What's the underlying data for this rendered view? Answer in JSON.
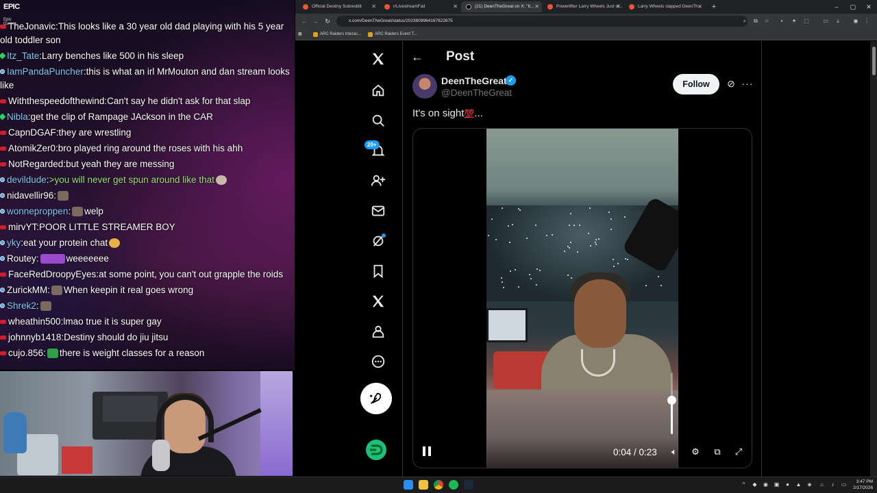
{
  "stream": {
    "logo_text": "EPIC",
    "logo_sub": "Epic Games",
    "chat": [
      {
        "badge": "red",
        "user": "TheJonavic",
        "text": "This looks like a 30 year old dad playing with his 5 year old toddler son",
        "user_color": "white"
      },
      {
        "badge": "green",
        "user": "Itz_Tate",
        "text": "Larry benches like 500 in his sleep",
        "user_color": "lblue"
      },
      {
        "badge": "blue",
        "user": "IamPandaPuncher",
        "text": "this is what an irl MrMouton and dan stream looks like",
        "user_color": "lblue"
      },
      {
        "badge": "red",
        "user": "Withthespeedofthewind",
        "text": "Can't say he didn't ask for that slap",
        "user_color": "white"
      },
      {
        "badge": "green",
        "user": "Nibla",
        "text": "get the clip of Rampage JAckson in the CAR",
        "user_color": "lblue"
      },
      {
        "badge": "red",
        "user": "CapnDGAF",
        "text": "they are wrestling",
        "user_color": "white"
      },
      {
        "badge": "red",
        "user": "AtomikZer0",
        "text": "bro played ring around the roses with his ahh",
        "user_color": "white"
      },
      {
        "badge": "red",
        "user": "NotRegarded",
        "text": "but yeah they are messing",
        "user_color": "white"
      },
      {
        "badge": "blue",
        "user": "devildude",
        "text": ">you will never get spun around like that",
        "user_color": "lblue",
        "text_color": "green"
      },
      {
        "badge": "blue",
        "user": "nidavellir96",
        "text": "",
        "user_color": "white"
      },
      {
        "badge": "blue",
        "user": "wonneproppen",
        "text": "welp",
        "user_color": "lblue"
      },
      {
        "badge": "red",
        "user": "mirvYT",
        "text": "POOR LITTLE STREAMER BOY",
        "user_color": "white"
      },
      {
        "badge": "blue",
        "user": "yky",
        "text": "eat your protein chat",
        "user_color": "lblue"
      },
      {
        "badge": "blue",
        "user": "Routey",
        "text": "weeeeeee",
        "user_color": "white"
      },
      {
        "badge": "red",
        "user": "FaceRedDroopyEyes",
        "text": "at some point, you can't out grapple the roids",
        "user_color": "white"
      },
      {
        "badge": "blue",
        "user": "ZurickMM",
        "text": "When keepin it real goes wrong",
        "user_color": "white"
      },
      {
        "badge": "blue",
        "user": "Shrek2",
        "text": "",
        "user_color": "lblue"
      },
      {
        "badge": "red",
        "user": "wheathin500",
        "text": "lmao true it is super gay",
        "user_color": "white"
      },
      {
        "badge": "red",
        "user": "johnnyb1418",
        "text": "Destiny should do jiu jitsu",
        "user_color": "white"
      },
      {
        "badge": "red",
        "user": "cujo.856",
        "text": "there is weight classes for a reason",
        "user_color": "white"
      }
    ]
  },
  "browser": {
    "tabs": [
      {
        "label": "Official Destiny Subreddit"
      },
      {
        "label": "r/LivestreamFail"
      },
      {
        "label": "(21) DeenTheGreat on X: \"It...",
        "active": true
      },
      {
        "label": "Powerlifter Larry Wheels Just sl..."
      },
      {
        "label": "Larry Wheels slapped DeenTh..."
      }
    ],
    "url": "x.com/DeenTheGreat/status/2023809964167822675",
    "bookmarks": [
      "ARC Raiders Interac...",
      "ARC Raiders Event T..."
    ]
  },
  "x": {
    "notif_count": "20+",
    "header_title": "Post",
    "display_name": "DeenTheGreat",
    "handle": "@DeenTheGreat",
    "follow_label": "Follow",
    "tweet_text": "It's on sight",
    "tweet_emoji": "💯",
    "tweet_suffix": "...",
    "video": {
      "timecode": "0:04 / 0:23",
      "progress": 0.174,
      "volume": 0.55
    }
  },
  "taskbar": {
    "time": "3:47 PM",
    "date": "2/17/2026"
  },
  "colors": {
    "x_blue": "#1d9bf0",
    "follow_bg": "#eff3f4",
    "chat_red_badge": "#d01c2c"
  }
}
